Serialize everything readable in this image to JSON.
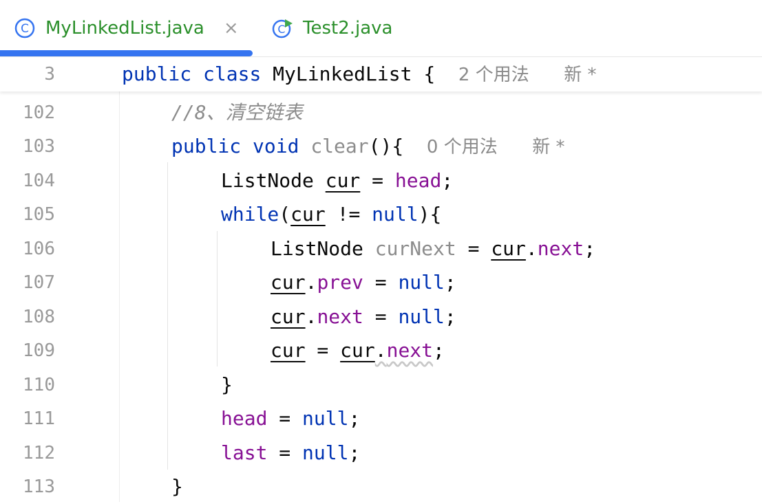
{
  "tabs": [
    {
      "label": "MyLinkedList.java",
      "close": "×",
      "icon": "class-c-icon"
    },
    {
      "label": "Test2.java",
      "icon": "run-test-class-icon"
    }
  ],
  "sticky": {
    "line_number": "3",
    "code": {
      "kw1": "public",
      "kw2": "class",
      "name": "MyLinkedList",
      "brace": "{"
    },
    "usages": "2 个用法",
    "new_tag": "新 *"
  },
  "lines": [
    {
      "num": "102",
      "comment": "//8、清空链表"
    },
    {
      "num": "103",
      "kw1": "public",
      "kw2": "void",
      "method": "clear",
      "rest": "(){",
      "usages": "0 个用法",
      "new_tag": "新 *"
    },
    {
      "num": "104",
      "type": "ListNode",
      "var": "cur",
      "eq": " = ",
      "field": "head",
      "semi": ";"
    },
    {
      "num": "105",
      "kw": "while",
      "open": "(",
      "var": "cur",
      "op": " != ",
      "null": "null",
      "close": "){"
    },
    {
      "num": "106",
      "type": "ListNode",
      "var": "curNext",
      "eq": " = ",
      "obj": "cur",
      "dot": ".",
      "field": "next",
      "semi": ";"
    },
    {
      "num": "107",
      "obj": "cur",
      "dot": ".",
      "field": "prev",
      "eq": " = ",
      "null": "null",
      "semi": ";"
    },
    {
      "num": "108",
      "obj": "cur",
      "dot": ".",
      "field": "next",
      "eq": " = ",
      "null": "null",
      "semi": ";"
    },
    {
      "num": "109",
      "var": "cur",
      "eq": " = ",
      "obj": "cur",
      "dot": ".",
      "field": "next",
      "semi": ";"
    },
    {
      "num": "110",
      "brace": "}"
    },
    {
      "num": "111",
      "field": "head",
      "eq": " = ",
      "null": "null",
      "semi": ";"
    },
    {
      "num": "112",
      "field": "last",
      "eq": " = ",
      "null": "null",
      "semi": ";"
    },
    {
      "num": "113",
      "brace": "}"
    }
  ],
  "colors": {
    "keyword": "#0033b3",
    "field": "#871094",
    "comment": "#8c8c8c",
    "tab_text": "#2a8f2a",
    "tab_underline": "#3574f0"
  }
}
